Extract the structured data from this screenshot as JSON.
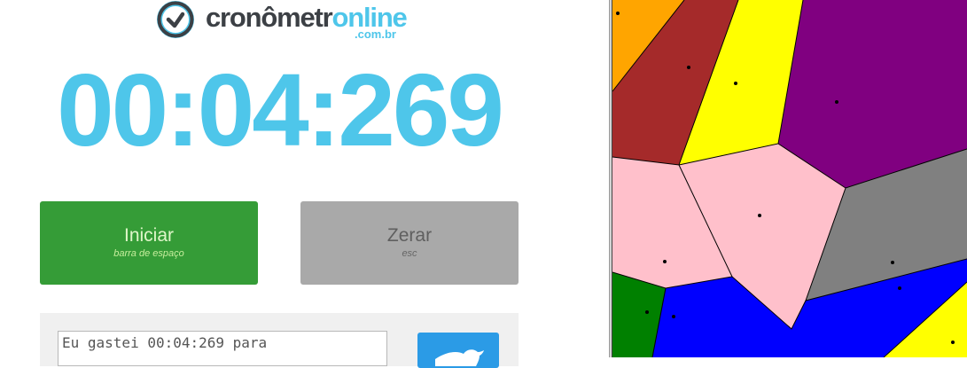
{
  "logo": {
    "word_main": "cronômetr",
    "word_accent": "online",
    "domain": ".com.br"
  },
  "timer": {
    "display": "00:04:269"
  },
  "buttons": {
    "start": {
      "label": "Iniciar",
      "hint": "barra de espaço"
    },
    "reset": {
      "label": "Zerar",
      "hint": "esc"
    }
  },
  "share": {
    "text": "Eu gastei 00:04:269 para"
  },
  "icons": {
    "logo": "clock-icon",
    "tweet": "twitter-bird-icon"
  },
  "colors": {
    "accent": "#4ec6ea",
    "start_button": "#359c37",
    "reset_button": "#a9a9a9",
    "tweet_button": "#2b9be6",
    "voronoi_regions": [
      "orange",
      "brown",
      "yellow",
      "purple",
      "pink",
      "grey",
      "green",
      "blue"
    ]
  }
}
